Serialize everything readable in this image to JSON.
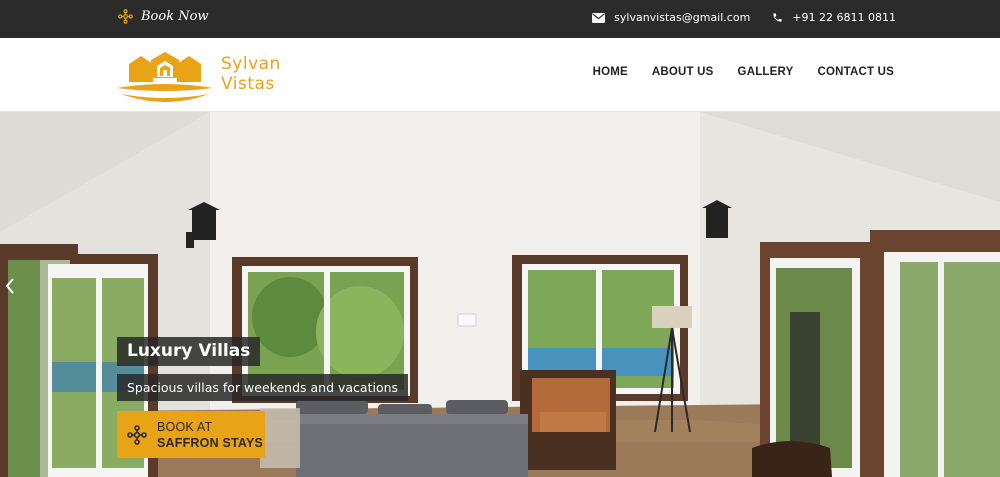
{
  "topbar": {
    "book_now_label": "Book Now",
    "book_now_icon": "saffron-flower-icon",
    "email": "sylvanvistas@gmail.com",
    "email_icon": "envelope-icon",
    "phone": "+91 22 6811 0811",
    "phone_icon": "phone-icon"
  },
  "header": {
    "logo_line1": "Sylvan",
    "logo_line2": "Vistas",
    "nav": [
      "HOME",
      "ABOUT US",
      "GALLERY",
      "CONTACT US"
    ]
  },
  "hero": {
    "title": "Luxury Villas",
    "subtitle": "Spacious villas for weekends and vacations",
    "cta_line1": "BOOK AT",
    "cta_line2": "SAFFRON STAYS",
    "cta_icon": "saffron-flower-icon",
    "prev_icon": "chevron-left-icon"
  },
  "colors": {
    "topbar_bg": "#2b2b2b",
    "brand_gold": "#e8a317",
    "nav_text": "#222222",
    "caption_bg": "#282828"
  }
}
